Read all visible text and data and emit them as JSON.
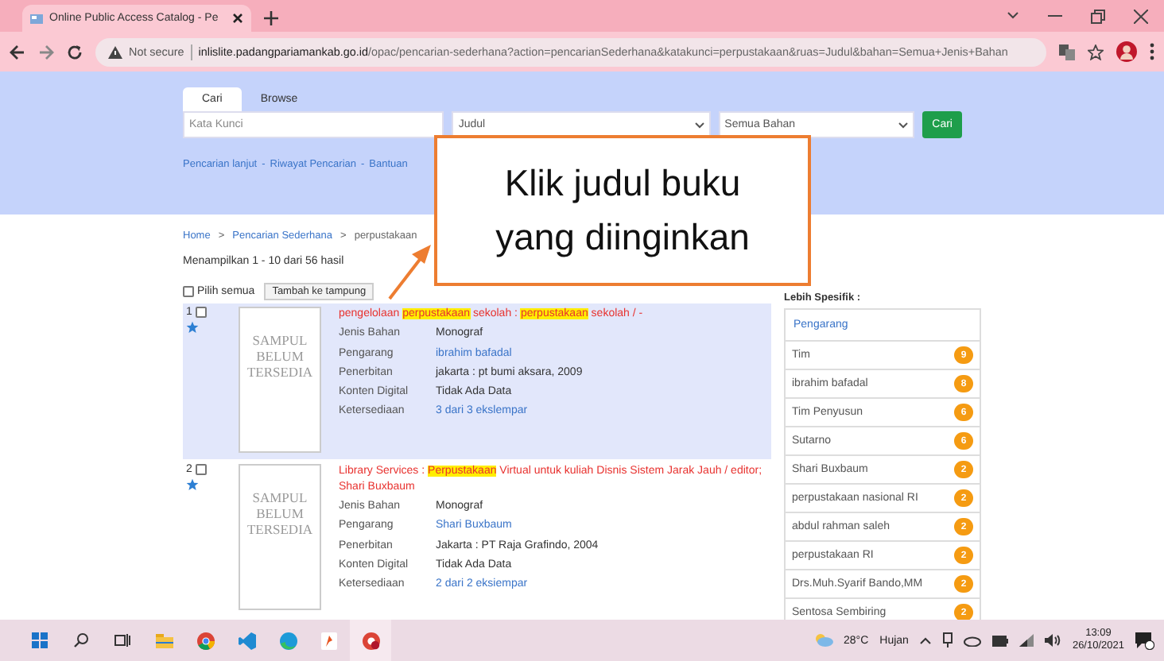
{
  "browser": {
    "tab_title": "Online Public Access Catalog - Pe",
    "security": "Not secure",
    "url_host": "inlislite.padangpariamankab.go.id",
    "url_path": "/opac/pencarian-sederhana?action=pencarianSederhana&katakunci=perpustakaan&ruas=Judul&bahan=Semua+Jenis+Bahan"
  },
  "search": {
    "tabs": [
      {
        "label": "Cari",
        "selected": true
      },
      {
        "label": "Browse",
        "selected": false
      }
    ],
    "keyword": {
      "placeholder": "Kata Kunci"
    },
    "field_select": "Judul",
    "material_select": "Semua Bahan",
    "button": "Cari",
    "links": [
      "Pencarian lanjut",
      "Riwayat Pencarian",
      "Bantuan"
    ],
    "link_separator": "-"
  },
  "breadcrumb": [
    "Home",
    "Pencarian Sederhana",
    "perpustakaan"
  ],
  "breadcrumb_separator": ">",
  "result_count": "Menampilkan 1 - 10 dari 56 hasil",
  "select_all": {
    "label": "Pilih semua",
    "checked": false
  },
  "add_button": "Tambah ke tampung",
  "results": [
    {
      "number": "1",
      "checked": false,
      "selected": true,
      "cover": "SAMPUL BELUM TERSEDIA",
      "title": [
        {
          "text": "pengelolaan ",
          "highlight": false
        },
        {
          "text": "perpustakaan",
          "highlight": true
        },
        {
          "text": " sekolah : ",
          "highlight": false
        },
        {
          "text": "perpustakaan",
          "highlight": true
        },
        {
          "text": " sekolah / -",
          "highlight": false
        }
      ],
      "fields": [
        {
          "label": "Jenis Bahan",
          "value": "Monograf",
          "kind": "text"
        },
        {
          "label": "Pengarang",
          "value": "ibrahim bafadal",
          "kind": "link"
        },
        {
          "label": "Penerbitan",
          "value": "jakarta : pt bumi aksara, 2009",
          "kind": "text"
        },
        {
          "label": "Konten Digital",
          "value": "Tidak Ada Data",
          "kind": "text"
        },
        {
          "label": "Ketersediaan",
          "value": "3 dari 3 ekslempar",
          "kind": "link"
        }
      ]
    },
    {
      "number": "2",
      "checked": false,
      "selected": false,
      "cover": "SAMPUL BELUM TERSEDIA",
      "title": [
        {
          "text": "Library Services : ",
          "highlight": false
        },
        {
          "text": "Perpustakaan",
          "highlight": true
        },
        {
          "text": " Virtual untuk kuliah Disnis Sistem Jarak Jauh / editor; Shari Buxbaum",
          "highlight": false
        }
      ],
      "fields": [
        {
          "label": "Jenis Bahan",
          "value": "Monograf",
          "kind": "text"
        },
        {
          "label": "Pengarang",
          "value": "Shari Buxbaum",
          "kind": "link"
        },
        {
          "label": "Penerbitan",
          "value": "Jakarta : PT Raja Grafindo, 2004",
          "kind": "text"
        },
        {
          "label": "Konten Digital",
          "value": "Tidak Ada Data",
          "kind": "text"
        },
        {
          "label": "Ketersediaan",
          "value": "2 dari 2 eksiempar",
          "kind": "link"
        }
      ]
    }
  ],
  "facets": {
    "title": "Lebih Spesifik :",
    "group": "Pengarang",
    "items": [
      {
        "name": "Tim",
        "count": "9"
      },
      {
        "name": "ibrahim bafadal",
        "count": "8"
      },
      {
        "name": "Tim Penyusun",
        "count": "6"
      },
      {
        "name": "Sutarno",
        "count": "6"
      },
      {
        "name": "Shari Buxbaum",
        "count": "2"
      },
      {
        "name": "perpustakaan nasional RI",
        "count": "2"
      },
      {
        "name": "abdul rahman saleh",
        "count": "2"
      },
      {
        "name": "perpustakaan RI",
        "count": "2"
      },
      {
        "name": "Drs.Muh.Syarif Bando,MM",
        "count": "2"
      },
      {
        "name": "Sentosa Sembiring",
        "count": "2"
      }
    ]
  },
  "callout": {
    "text": "Klik judul buku yang diinginkan"
  },
  "taskbar": {
    "temperature": "28°C",
    "weather": "Hujan",
    "time": "13:09",
    "date": "26/10/2021"
  }
}
